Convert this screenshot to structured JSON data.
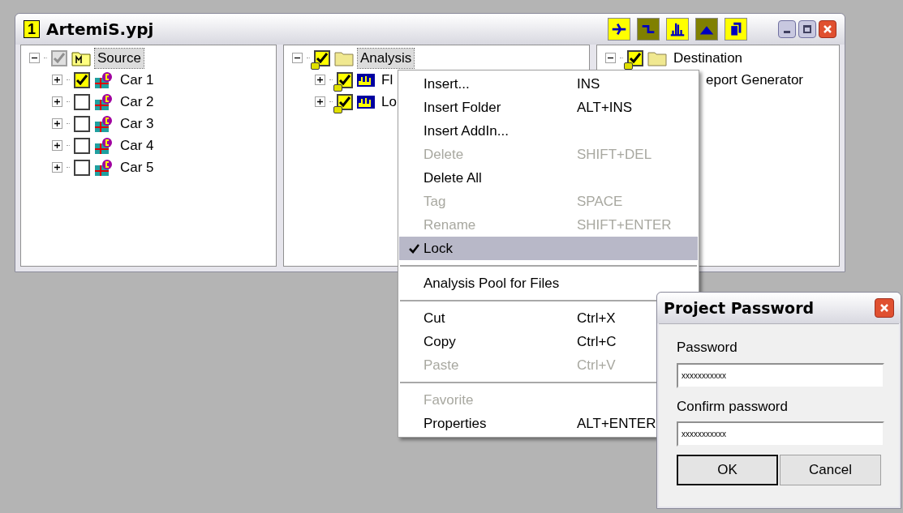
{
  "window": {
    "badge": "1",
    "title": "ArtemiS.ypj",
    "toolbar": [
      {
        "on": true
      },
      {
        "on": false
      },
      {
        "on": true
      },
      {
        "on": false
      },
      {
        "on": true
      }
    ]
  },
  "panes": [
    {
      "tree": [
        {
          "label": "Source",
          "kind": "source",
          "expanded": true,
          "checked": true,
          "dimmed": true,
          "locked": false,
          "selected": true,
          "children": [
            {
              "label": "Car 1",
              "kind": "car",
              "expanded": false,
              "checked": true,
              "dimmed": false,
              "locked": false,
              "selected": false
            },
            {
              "label": "Car 2",
              "kind": "car",
              "expanded": false,
              "checked": false,
              "dimmed": false,
              "locked": false,
              "selected": false
            },
            {
              "label": "Car 3",
              "kind": "car",
              "expanded": false,
              "checked": false,
              "dimmed": false,
              "locked": false,
              "selected": false
            },
            {
              "label": "Car 4",
              "kind": "car",
              "expanded": false,
              "checked": false,
              "dimmed": false,
              "locked": false,
              "selected": false
            },
            {
              "label": "Car 5",
              "kind": "car",
              "expanded": false,
              "checked": false,
              "dimmed": false,
              "locked": false,
              "selected": false
            }
          ]
        }
      ]
    },
    {
      "tree": [
        {
          "label": "Analysis",
          "kind": "folder",
          "expanded": true,
          "checked": true,
          "dimmed": false,
          "locked": true,
          "selected": true,
          "children": [
            {
              "label": "Fl",
              "kind": "analysis",
              "expanded": false,
              "checked": true,
              "dimmed": false,
              "locked": true,
              "selected": false
            },
            {
              "label": "Lo",
              "kind": "analysis",
              "expanded": false,
              "checked": true,
              "dimmed": false,
              "locked": true,
              "selected": false
            }
          ]
        }
      ]
    },
    {
      "tree": [
        {
          "label": "Destination",
          "kind": "folder",
          "expanded": true,
          "checked": true,
          "dimmed": false,
          "locked": true,
          "selected": false,
          "children": [
            {
              "label": "eport Generator",
              "kind": "hidden",
              "selected": false
            }
          ]
        }
      ]
    }
  ],
  "context_menu": [
    {
      "kind": "item",
      "label": "Insert...",
      "shortcut": "INS",
      "disabled": false,
      "checked": false,
      "selected": false
    },
    {
      "kind": "item",
      "label": "Insert Folder",
      "shortcut": "ALT+INS",
      "disabled": false,
      "checked": false,
      "selected": false
    },
    {
      "kind": "item",
      "label": "Insert AddIn...",
      "disabled": false,
      "checked": false,
      "selected": false
    },
    {
      "kind": "item",
      "label": "Delete",
      "shortcut": "SHIFT+DEL",
      "disabled": true,
      "checked": false,
      "selected": false
    },
    {
      "kind": "item",
      "label": "Delete All",
      "disabled": false,
      "checked": false,
      "selected": false
    },
    {
      "kind": "item",
      "label": "Tag",
      "shortcut": "SPACE",
      "disabled": true,
      "checked": false,
      "selected": false
    },
    {
      "kind": "item",
      "label": "Rename",
      "shortcut": "SHIFT+ENTER",
      "disabled": true,
      "checked": false,
      "selected": false
    },
    {
      "kind": "item",
      "label": "Lock",
      "disabled": false,
      "checked": true,
      "selected": true
    },
    {
      "kind": "separator"
    },
    {
      "kind": "item",
      "label": "Analysis Pool for Files",
      "disabled": false,
      "checked": false,
      "selected": false
    },
    {
      "kind": "separator"
    },
    {
      "kind": "item",
      "label": "Cut",
      "shortcut": "Ctrl+X",
      "disabled": false,
      "checked": false,
      "selected": false
    },
    {
      "kind": "item",
      "label": "Copy",
      "shortcut": "Ctrl+C",
      "disabled": false,
      "checked": false,
      "selected": false
    },
    {
      "kind": "item",
      "label": "Paste",
      "shortcut": "Ctrl+V",
      "disabled": true,
      "checked": false,
      "selected": false
    },
    {
      "kind": "separator"
    },
    {
      "kind": "item",
      "label": "Favorite",
      "disabled": true,
      "checked": false,
      "selected": false
    },
    {
      "kind": "item",
      "label": "Properties",
      "shortcut": "ALT+ENTER",
      "disabled": false,
      "checked": false,
      "selected": false
    }
  ],
  "dialog": {
    "title": "Project Password",
    "fields": [
      {
        "label": "Password",
        "value": "xxxxxxxxxxx"
      },
      {
        "label": "Confirm password",
        "value": "xxxxxxxxxxx"
      }
    ],
    "buttons": [
      {
        "label": "OK",
        "default": true
      },
      {
        "label": "Cancel",
        "default": false
      }
    ]
  }
}
